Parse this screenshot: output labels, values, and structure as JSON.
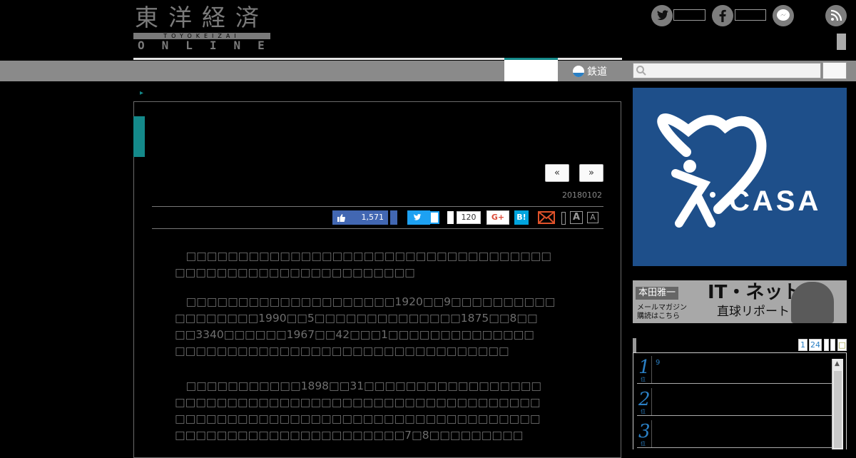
{
  "header": {
    "logo_kanji": "東洋経済",
    "logo_band": "TOYOKEIZAI",
    "logo_online": "ONLINE",
    "social": [
      {
        "name": "twitter",
        "glyph": "🐦"
      },
      {
        "name": "facebook",
        "glyph": "f"
      },
      {
        "name": "messenger",
        "glyph": "~"
      },
      {
        "name": "rss",
        "glyph": "⌒"
      }
    ]
  },
  "nav": {
    "rail_label": "鉄道",
    "search_placeholder": ""
  },
  "breadcrumb": {
    "arrow": "▸"
  },
  "article": {
    "prev_label": "«",
    "next_label": "»",
    "date": "20180102",
    "share": {
      "like_count": "1,571",
      "pocket_count": "120",
      "gplus_label": "G+",
      "hatena_label": "B!",
      "font_large": "A",
      "font_small": "A"
    },
    "paragraphs": [
      [
        "　□□□□□□□□□□□□□□□□□□□□□□□□□□□□□□□□□□□",
        "□□□□□□□□□□□□□□□□□□□□□□□"
      ],
      [
        "　□□□□□□□□□□□□□□□□□□□□1920□□9□□□□□□□□□□",
        "□□□□□□□□1990□□5□□□□□□□□□□□□□□1875□□8□□",
        "□□3340□□□□□□1967□□42□□□1□□□□□□□□□□□□□□",
        "□□□□□□□□□□□□□□□□□□□□□□□□□□□□□□□□"
      ],
      [
        "　□□□□□□□□□□□1898□□31□□□□□□□□□□□□□□□□□",
        "□□□□□□□□□□□□□□□□□□□□□□□□□□□□□□□□□□□",
        "□□□□□□□□□□□□□□□□□□□□□□□□□□□□□□□□□□□",
        "□□□□□□□□□□□□□□□□□□□□□□7□8□□□□□□□□□"
      ]
    ]
  },
  "sidebar": {
    "ad_brand": "CASA",
    "banner": {
      "name": "本田雅一",
      "title": "IT・ネット",
      "sub_line1": "メールマガジン",
      "sub_line2": "購読はこちら",
      "sub_title": "直球リポート"
    },
    "ranking_tabs": [
      "1",
      "24",
      "",
      "",
      "□"
    ],
    "ranking": [
      {
        "rank": "1",
        "suffix": "位",
        "text": "9"
      },
      {
        "rank": "2",
        "suffix": "位",
        "text": ""
      },
      {
        "rank": "3",
        "suffix": "位",
        "text": ""
      }
    ]
  },
  "colors": {
    "accent": "#14898a",
    "link": "#2a7fc4",
    "ad_bg": "#1e4f8a"
  }
}
